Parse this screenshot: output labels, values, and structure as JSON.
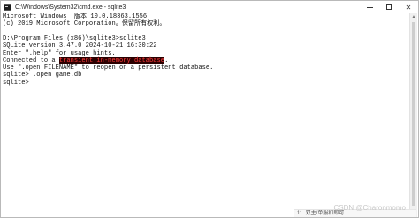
{
  "window": {
    "title": "C:\\Windows\\System32\\cmd.exe - sqlite3",
    "controls": {
      "minimize_icon": "minimize-icon",
      "maximize_icon": "maximize-icon",
      "close_symbol": "✕"
    }
  },
  "console": {
    "lines": [
      "Microsoft Windows [版本 10.0.18363.1556]",
      "(c) 2019 Microsoft Corporation。保留所有权利。",
      "",
      "D:\\Program Files (x86)\\sqlite3>sqlite3",
      "SQLite version 3.47.0 2024-10-21 16:30:22",
      "Enter \".help\" for usage hints.",
      "Connected to a ",
      "Use \".open FILENAME\" to reopen on a persistent database.",
      "sqlite> .open game.db",
      "sqlite>"
    ],
    "highlight": "transient in-memory database",
    "highlight_suffix": "."
  },
  "watermark": "CSDN @Charonmomo",
  "background_strip": {
    "prefix": "",
    "text": "11. 双主/单服和即可"
  }
}
